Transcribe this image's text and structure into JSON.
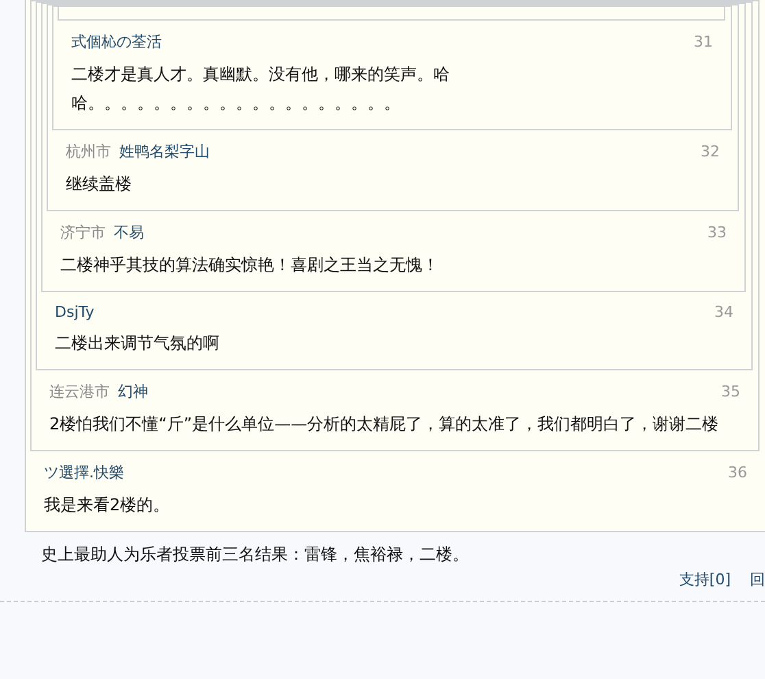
{
  "post": {
    "thread": {
      "user": "ツ選擇.快樂",
      "floor": "36",
      "text": "我是来看2楼的。",
      "quote": {
        "city": "连云港市",
        "user": "幻神",
        "floor": "35",
        "text": "2楼怕我们不懂“斤”是什么单位——分析的太精屁了，算的太准了，我们都明白了，谢谢二楼",
        "quote": {
          "user": "DsjTy",
          "floor": "34",
          "text": "二楼出来调节气氛的啊",
          "quote": {
            "city": "济宁市",
            "user": "不易",
            "floor": "33",
            "text": "二楼神乎其技的算法确实惊艳！喜剧之王当之无愧！",
            "quote": {
              "city": "杭州市",
              "user": "姓鸭名梨字山",
              "floor": "32",
              "text": "继续盖楼",
              "quote": {
                "user": "式個杺の荃活",
                "floor": "31",
                "text": "二楼才是真人才。真幽默。没有他，哪来的笑声。哈哈。。。。。。。。。。。。。。。。。。。",
                "quote": {
                  "kind": "partial"
                }
              }
            }
          }
        }
      }
    },
    "text": "史上最助人为乐者投票前三名结果：雷锋，焦裕禄，二楼。",
    "actions": [
      "支持[0]",
      "回"
    ]
  }
}
